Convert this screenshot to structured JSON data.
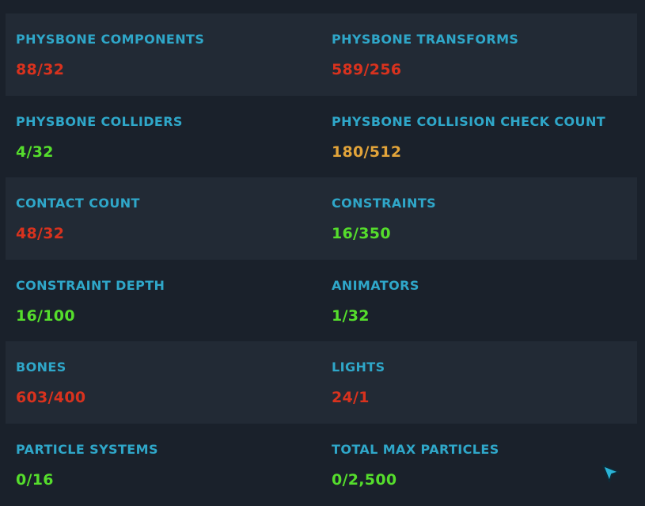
{
  "colors": {
    "background": "#1a212b",
    "row_shaded": "#222a35",
    "label": "#2fa7c9",
    "over_limit": "#d8321e",
    "ok": "#55dd2c",
    "warning": "#e2a43a",
    "cursor": "#2ab3d6"
  },
  "stats": [
    {
      "label": "PHYSBONE COMPONENTS",
      "value": "88/32",
      "status": "red"
    },
    {
      "label": "PHYSBONE TRANSFORMS",
      "value": "589/256",
      "status": "red"
    },
    {
      "label": "PHYSBONE COLLIDERS",
      "value": "4/32",
      "status": "green"
    },
    {
      "label": "PHYSBONE COLLISION CHECK COUNT",
      "value": "180/512",
      "status": "orange"
    },
    {
      "label": "CONTACT COUNT",
      "value": "48/32",
      "status": "red"
    },
    {
      "label": "CONSTRAINTS",
      "value": "16/350",
      "status": "green"
    },
    {
      "label": "CONSTRAINT DEPTH",
      "value": "16/100",
      "status": "green"
    },
    {
      "label": "ANIMATORS",
      "value": "1/32",
      "status": "green"
    },
    {
      "label": "BONES",
      "value": "603/400",
      "status": "red"
    },
    {
      "label": "LIGHTS",
      "value": "24/1",
      "status": "red"
    },
    {
      "label": "PARTICLE SYSTEMS",
      "value": "0/16",
      "status": "green"
    },
    {
      "label": "TOTAL MAX PARTICLES",
      "value": "0/2,500",
      "status": "green"
    }
  ],
  "cursor": {
    "icon": "pointer-arrow-icon"
  }
}
